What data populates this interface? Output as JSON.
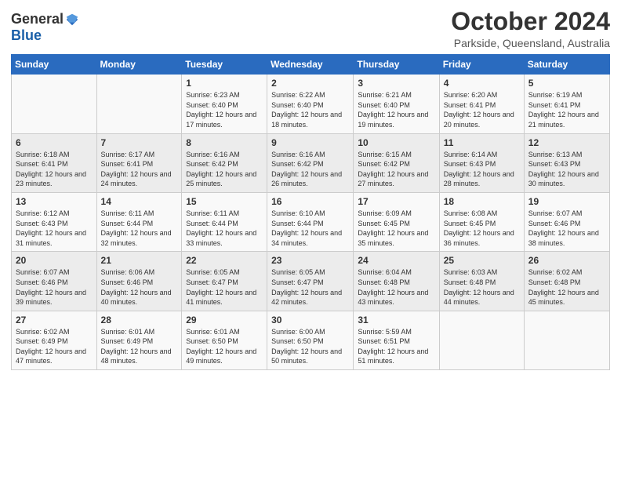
{
  "logo": {
    "general": "General",
    "blue": "Blue"
  },
  "header": {
    "month": "October 2024",
    "location": "Parkside, Queensland, Australia"
  },
  "weekdays": [
    "Sunday",
    "Monday",
    "Tuesday",
    "Wednesday",
    "Thursday",
    "Friday",
    "Saturday"
  ],
  "weeks": [
    [
      {
        "day": "",
        "sunrise": "",
        "sunset": "",
        "daylight": ""
      },
      {
        "day": "",
        "sunrise": "",
        "sunset": "",
        "daylight": ""
      },
      {
        "day": "1",
        "sunrise": "Sunrise: 6:23 AM",
        "sunset": "Sunset: 6:40 PM",
        "daylight": "Daylight: 12 hours and 17 minutes."
      },
      {
        "day": "2",
        "sunrise": "Sunrise: 6:22 AM",
        "sunset": "Sunset: 6:40 PM",
        "daylight": "Daylight: 12 hours and 18 minutes."
      },
      {
        "day": "3",
        "sunrise": "Sunrise: 6:21 AM",
        "sunset": "Sunset: 6:40 PM",
        "daylight": "Daylight: 12 hours and 19 minutes."
      },
      {
        "day": "4",
        "sunrise": "Sunrise: 6:20 AM",
        "sunset": "Sunset: 6:41 PM",
        "daylight": "Daylight: 12 hours and 20 minutes."
      },
      {
        "day": "5",
        "sunrise": "Sunrise: 6:19 AM",
        "sunset": "Sunset: 6:41 PM",
        "daylight": "Daylight: 12 hours and 21 minutes."
      }
    ],
    [
      {
        "day": "6",
        "sunrise": "Sunrise: 6:18 AM",
        "sunset": "Sunset: 6:41 PM",
        "daylight": "Daylight: 12 hours and 23 minutes."
      },
      {
        "day": "7",
        "sunrise": "Sunrise: 6:17 AM",
        "sunset": "Sunset: 6:41 PM",
        "daylight": "Daylight: 12 hours and 24 minutes."
      },
      {
        "day": "8",
        "sunrise": "Sunrise: 6:16 AM",
        "sunset": "Sunset: 6:42 PM",
        "daylight": "Daylight: 12 hours and 25 minutes."
      },
      {
        "day": "9",
        "sunrise": "Sunrise: 6:16 AM",
        "sunset": "Sunset: 6:42 PM",
        "daylight": "Daylight: 12 hours and 26 minutes."
      },
      {
        "day": "10",
        "sunrise": "Sunrise: 6:15 AM",
        "sunset": "Sunset: 6:42 PM",
        "daylight": "Daylight: 12 hours and 27 minutes."
      },
      {
        "day": "11",
        "sunrise": "Sunrise: 6:14 AM",
        "sunset": "Sunset: 6:43 PM",
        "daylight": "Daylight: 12 hours and 28 minutes."
      },
      {
        "day": "12",
        "sunrise": "Sunrise: 6:13 AM",
        "sunset": "Sunset: 6:43 PM",
        "daylight": "Daylight: 12 hours and 30 minutes."
      }
    ],
    [
      {
        "day": "13",
        "sunrise": "Sunrise: 6:12 AM",
        "sunset": "Sunset: 6:43 PM",
        "daylight": "Daylight: 12 hours and 31 minutes."
      },
      {
        "day": "14",
        "sunrise": "Sunrise: 6:11 AM",
        "sunset": "Sunset: 6:44 PM",
        "daylight": "Daylight: 12 hours and 32 minutes."
      },
      {
        "day": "15",
        "sunrise": "Sunrise: 6:11 AM",
        "sunset": "Sunset: 6:44 PM",
        "daylight": "Daylight: 12 hours and 33 minutes."
      },
      {
        "day": "16",
        "sunrise": "Sunrise: 6:10 AM",
        "sunset": "Sunset: 6:44 PM",
        "daylight": "Daylight: 12 hours and 34 minutes."
      },
      {
        "day": "17",
        "sunrise": "Sunrise: 6:09 AM",
        "sunset": "Sunset: 6:45 PM",
        "daylight": "Daylight: 12 hours and 35 minutes."
      },
      {
        "day": "18",
        "sunrise": "Sunrise: 6:08 AM",
        "sunset": "Sunset: 6:45 PM",
        "daylight": "Daylight: 12 hours and 36 minutes."
      },
      {
        "day": "19",
        "sunrise": "Sunrise: 6:07 AM",
        "sunset": "Sunset: 6:46 PM",
        "daylight": "Daylight: 12 hours and 38 minutes."
      }
    ],
    [
      {
        "day": "20",
        "sunrise": "Sunrise: 6:07 AM",
        "sunset": "Sunset: 6:46 PM",
        "daylight": "Daylight: 12 hours and 39 minutes."
      },
      {
        "day": "21",
        "sunrise": "Sunrise: 6:06 AM",
        "sunset": "Sunset: 6:46 PM",
        "daylight": "Daylight: 12 hours and 40 minutes."
      },
      {
        "day": "22",
        "sunrise": "Sunrise: 6:05 AM",
        "sunset": "Sunset: 6:47 PM",
        "daylight": "Daylight: 12 hours and 41 minutes."
      },
      {
        "day": "23",
        "sunrise": "Sunrise: 6:05 AM",
        "sunset": "Sunset: 6:47 PM",
        "daylight": "Daylight: 12 hours and 42 minutes."
      },
      {
        "day": "24",
        "sunrise": "Sunrise: 6:04 AM",
        "sunset": "Sunset: 6:48 PM",
        "daylight": "Daylight: 12 hours and 43 minutes."
      },
      {
        "day": "25",
        "sunrise": "Sunrise: 6:03 AM",
        "sunset": "Sunset: 6:48 PM",
        "daylight": "Daylight: 12 hours and 44 minutes."
      },
      {
        "day": "26",
        "sunrise": "Sunrise: 6:02 AM",
        "sunset": "Sunset: 6:48 PM",
        "daylight": "Daylight: 12 hours and 45 minutes."
      }
    ],
    [
      {
        "day": "27",
        "sunrise": "Sunrise: 6:02 AM",
        "sunset": "Sunset: 6:49 PM",
        "daylight": "Daylight: 12 hours and 47 minutes."
      },
      {
        "day": "28",
        "sunrise": "Sunrise: 6:01 AM",
        "sunset": "Sunset: 6:49 PM",
        "daylight": "Daylight: 12 hours and 48 minutes."
      },
      {
        "day": "29",
        "sunrise": "Sunrise: 6:01 AM",
        "sunset": "Sunset: 6:50 PM",
        "daylight": "Daylight: 12 hours and 49 minutes."
      },
      {
        "day": "30",
        "sunrise": "Sunrise: 6:00 AM",
        "sunset": "Sunset: 6:50 PM",
        "daylight": "Daylight: 12 hours and 50 minutes."
      },
      {
        "day": "31",
        "sunrise": "Sunrise: 5:59 AM",
        "sunset": "Sunset: 6:51 PM",
        "daylight": "Daylight: 12 hours and 51 minutes."
      },
      {
        "day": "",
        "sunrise": "",
        "sunset": "",
        "daylight": ""
      },
      {
        "day": "",
        "sunrise": "",
        "sunset": "",
        "daylight": ""
      }
    ]
  ]
}
